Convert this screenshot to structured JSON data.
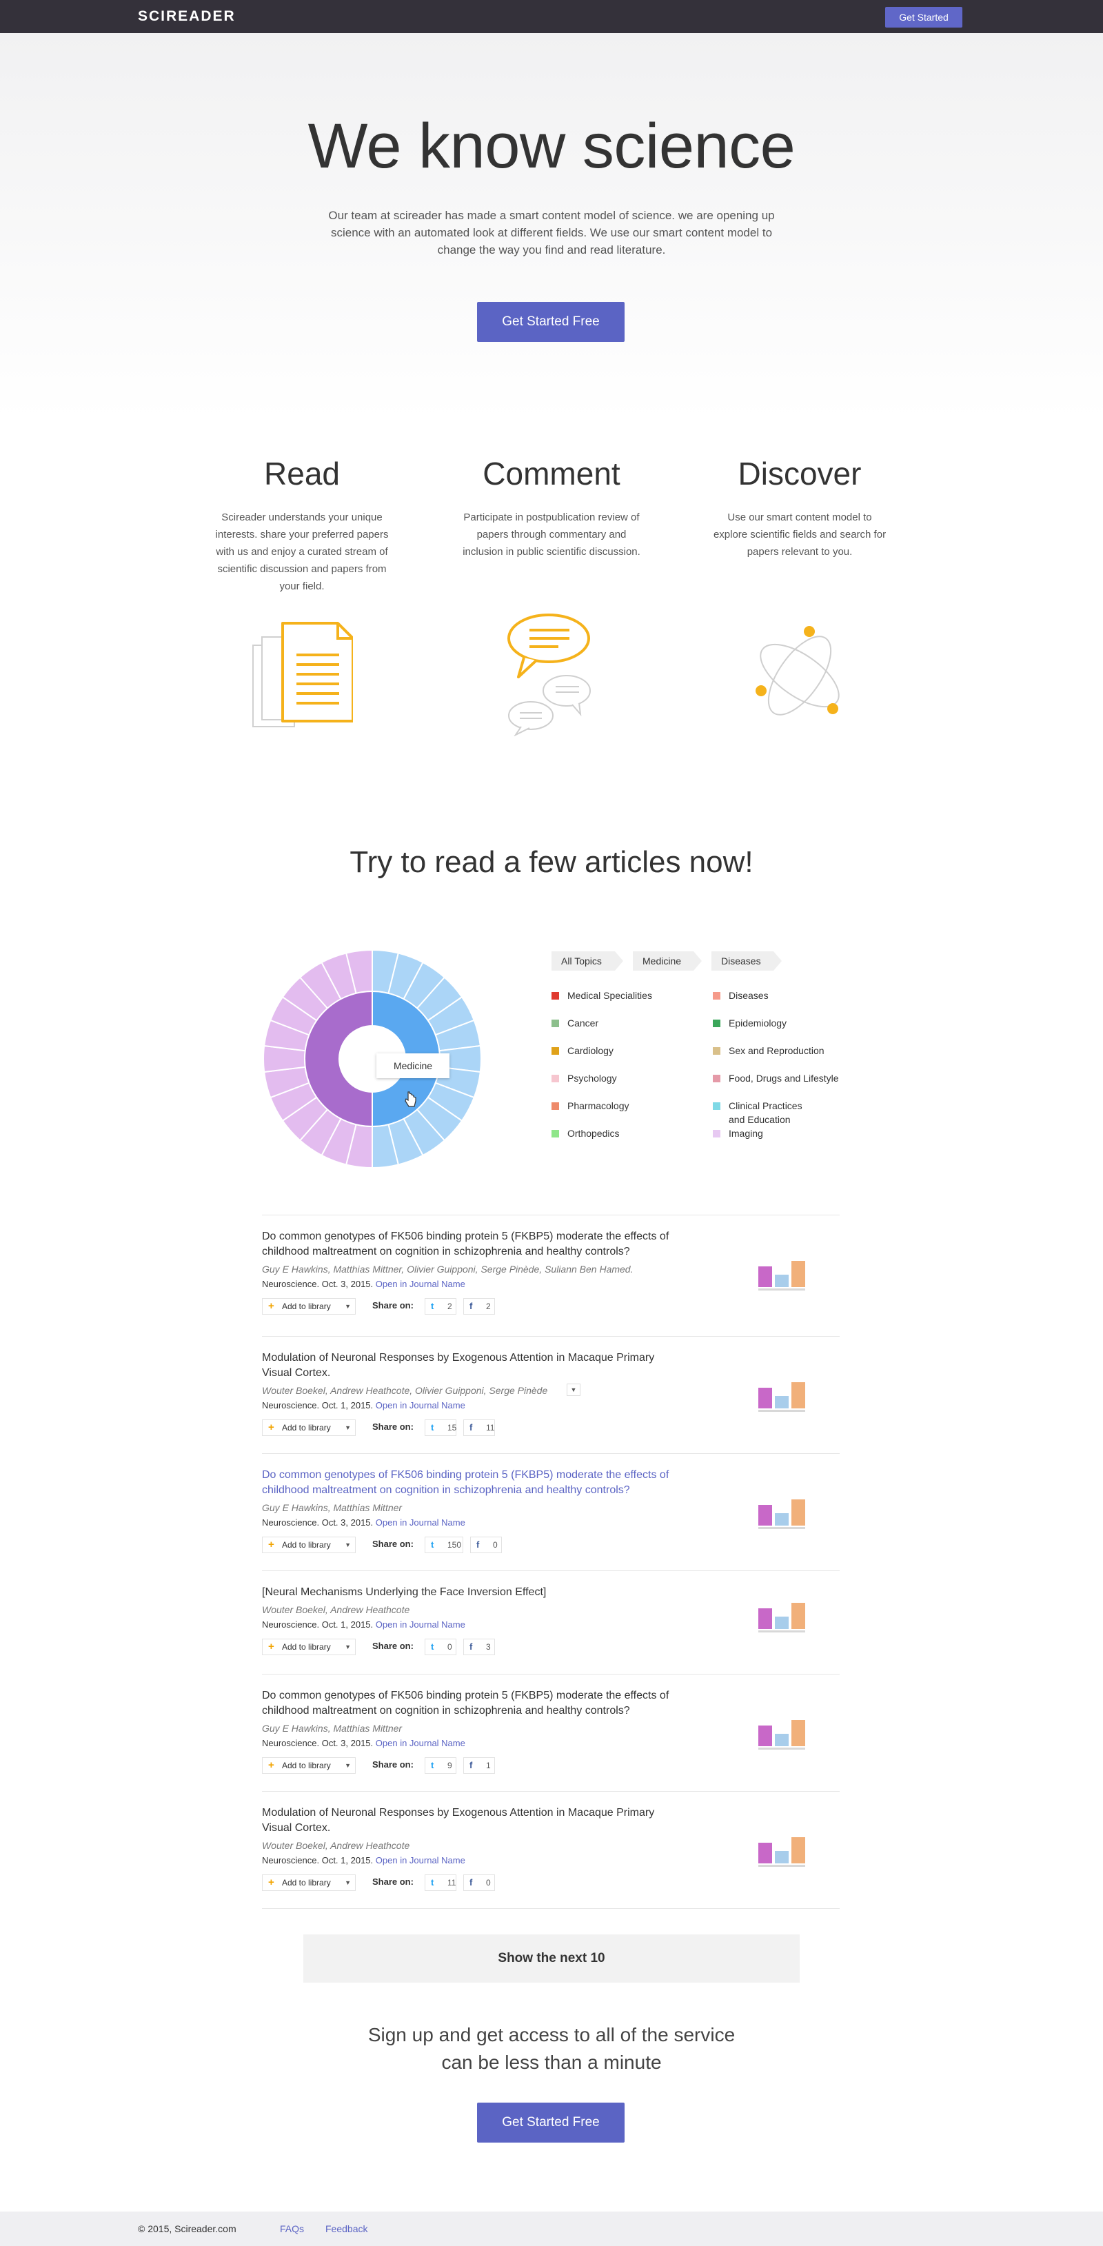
{
  "nav": {
    "logo": "SCIREADER",
    "cta": "Get Started"
  },
  "hero": {
    "title": "We know science",
    "description": "Our team at scireader has made a smart content model of science. we are opening up science with an automated look at different fields. We use our smart content model to change the way you find and read literature.",
    "cta": "Get Started Free"
  },
  "features": [
    {
      "title": "Read",
      "text": "Scireader understands your unique interests. share your preferred papers with us and enjoy a curated stream of scientific discussion and papers from your field.",
      "icon": "documents-icon"
    },
    {
      "title": "Comment",
      "text": "Participate in postpublication review of papers through commentary and inclusion in public scientific discussion.",
      "icon": "chat-bubbles-icon"
    },
    {
      "title": "Discover",
      "text": "Use our smart content model to explore scientific fields and search for papers relevant to you.",
      "icon": "atom-icon"
    }
  ],
  "articles_section": {
    "title": "Try to read a few articles now!",
    "chart_tooltip": "Medicine",
    "breadcrumb": [
      "All Topics",
      "Medicine",
      "Diseases"
    ],
    "legend": [
      {
        "label": "Medical Specialities",
        "color": "#e03a2f"
      },
      {
        "label": "Diseases",
        "color": "#f59a8a"
      },
      {
        "label": "Cancer",
        "color": "#8cbf8c"
      },
      {
        "label": "Epidemiology",
        "color": "#3aa65a"
      },
      {
        "label": "Cardiology",
        "color": "#e0a21a"
      },
      {
        "label": "Sex and Reproduction",
        "color": "#d9c08a"
      },
      {
        "label": "Psychology",
        "color": "#f6c6cf"
      },
      {
        "label": "Food, Drugs and Lifestyle",
        "color": "#e59aa8"
      },
      {
        "label": "Pharmacology",
        "color": "#ee8a6a"
      },
      {
        "label": "Clinical Practices and Education",
        "color": "#7fd9e6"
      },
      {
        "label": "Orthopedics",
        "color": "#8fe68a"
      },
      {
        "label": "Imaging",
        "color": "#e7c9f2"
      }
    ],
    "add_label": "Add to library",
    "share_label": "Share on:",
    "journal_link": "Open in Journal Name",
    "articles": [
      {
        "title": "Do common genotypes of FK506 binding protein 5 (FKBP5) moderate the effects of childhood maltreatment on cognition in schizophrenia and healthy controls?",
        "authors": "Guy E Hawkins, Matthias Mittner, Olivier Guipponi, Serge Pinède, Suliann Ben Hamed.",
        "meta": "Neuroscience. Oct. 3, 2015.",
        "twitter": "2",
        "facebook": "2"
      },
      {
        "title": "Modulation of Neuronal Responses by Exogenous Attention in Macaque Primary Visual Cortex.",
        "authors": "Wouter Boekel, Andrew Heathcote, Olivier Guipponi, Serge Pinède",
        "meta": "Neuroscience. Oct. 1, 2015.",
        "twitter": "15",
        "facebook": "11"
      },
      {
        "title": "Do common genotypes of FK506 binding protein 5 (FKBP5) moderate the effects of childhood maltreatment on cognition in schizophrenia and healthy controls?",
        "authors": "Guy E Hawkins, Matthias Mittner",
        "meta": "Neuroscience. Oct. 3, 2015.",
        "twitter": "150",
        "facebook": "0"
      },
      {
        "title": "[Neural Mechanisms Underlying the Face Inversion Effect]",
        "authors": "Wouter Boekel, Andrew Heathcote",
        "meta": "Neuroscience. Oct. 1, 2015.",
        "twitter": "0",
        "facebook": "3"
      },
      {
        "title": "Do common genotypes of FK506 binding protein 5 (FKBP5) moderate the effects of childhood maltreatment on cognition in schizophrenia and healthy controls?",
        "authors": "Guy E Hawkins, Matthias Mittner",
        "meta": "Neuroscience. Oct. 3, 2015.",
        "twitter": "9",
        "facebook": "1"
      },
      {
        "title": "Modulation of Neuronal Responses by Exogenous Attention in Macaque Primary Visual Cortex.",
        "authors": "Wouter Boekel, Andrew Heathcote",
        "meta": "Neuroscience. Oct. 1, 2015.",
        "twitter": "11",
        "facebook": "0"
      }
    ],
    "show_more": "Show the next 10"
  },
  "signup": {
    "line1": "Sign up and get access to all of the service",
    "line2": "can be less than a minute",
    "cta": "Get Started Free"
  },
  "footer": {
    "copyright": "© 2015, Scireader.com",
    "links": [
      "FAQs",
      "Feedback"
    ]
  },
  "colors": {
    "accent": "#5b64c4",
    "nav_bg": "#34313a",
    "icon_orange": "#f5b21b"
  }
}
